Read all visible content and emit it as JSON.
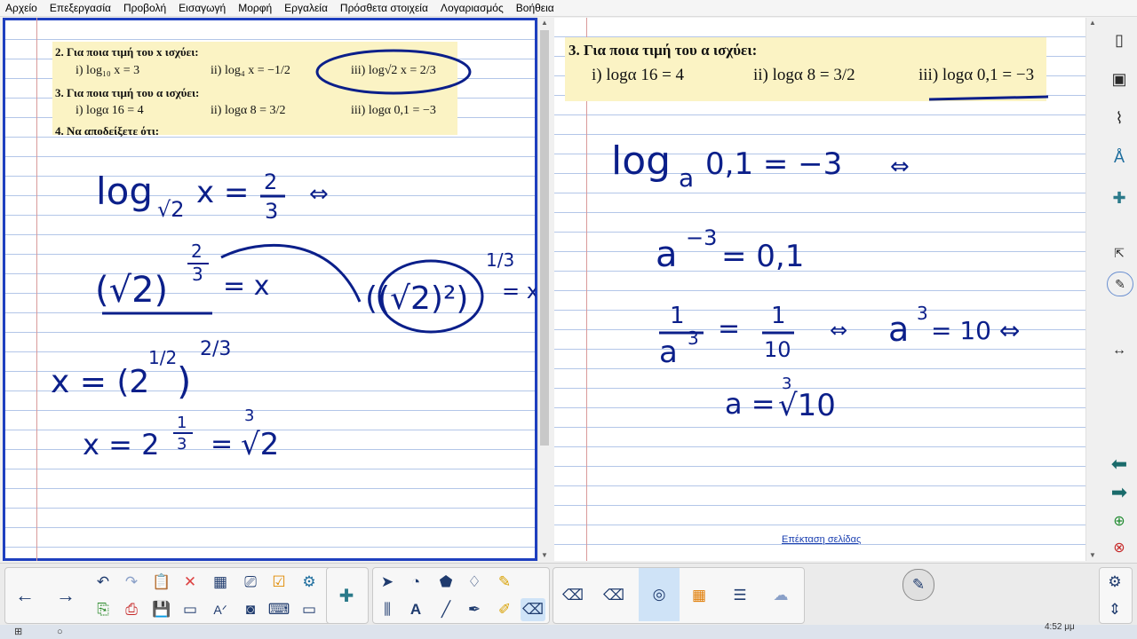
{
  "menu": [
    "Αρχείο",
    "Επεξεργασία",
    "Προβολή",
    "Εισαγωγή",
    "Μορφή",
    "Εργαλεία",
    "Πρόσθετα στοιχεία",
    "Λογαριασμός",
    "Βοήθεια"
  ],
  "left_snippet": {
    "q2_heading": "2. Για ποια τιμή του x ισχύει:",
    "q2_i": "i) log₁₀ x = 3",
    "q2_ii": "ii) log₄ x = −1/2",
    "q2_iii": "iii) log√2 x = 2/3",
    "q3_heading": "3. Για ποια τιμή του α ισχύει:",
    "q3_i": "i) logα 16 = 4",
    "q3_ii": "ii) logα 8 = 3/2",
    "q3_iii": "iii) logα 0,1 = −3",
    "q4_heading": "4. Να αποδείξετε ότι:"
  },
  "right_snippet": {
    "q3_heading": "3. Για ποια τιμή του α ισχύει:",
    "q3_i": "i) logα 16 = 4",
    "q3_ii": "ii) logα 8 = 3/2",
    "q3_iii": "iii) logα 0,1 = −3"
  },
  "left_handwriting": {
    "l1a": "log",
    "l1b": "√2",
    "l1c": "x =",
    "l1d": "2",
    "l1e": "3",
    "l1f": "⇔",
    "l2a": "(√2)",
    "l2b": "2",
    "l2c": "3",
    "l2d": "= x",
    "l2e": "((√2)²)",
    "l2f": "1/3",
    "l2g": "= x",
    "l3a": "x = (2",
    "l3b": "1/2",
    "l3c": ")",
    "l3d": "2/3",
    "l4a": "x = 2",
    "l4b": "1",
    "l4c": "3",
    "l4d": "=",
    "l4e": "3",
    "l4f": "√2"
  },
  "right_handwriting": {
    "r1a": "log",
    "r1b": "a",
    "r1c": "0,1 = −3",
    "r1d": "⇔",
    "r2a": "a",
    "r2b": "−3",
    "r2c": "= 0,1",
    "r3a": "1",
    "r3b": "a",
    "r3c": "3",
    "r3d": "=",
    "r3e": "1",
    "r3f": "10",
    "r3g": "⇔",
    "r3h": "a",
    "r3i": "3",
    "r3j": "= 10 ⇔",
    "r4a": "a =",
    "r4b": "3",
    "r4c": "√10"
  },
  "page_extension_link": "Επέκταση σελίδας",
  "taskbar": {
    "time": "4:52 μμ"
  },
  "icons": {
    "right_toolbar": [
      "page-icon",
      "gallery-icon",
      "attachment-icon",
      "properties-icon",
      "addons-icon",
      "collapse-icon",
      "pen-icon",
      "resize-icon",
      "previous-page-icon",
      "next-page-icon",
      "add-page-icon",
      "delete-page-icon"
    ],
    "bottom_toolbar": [
      "previous-arrow-icon",
      "next-arrow-icon",
      "undo-icon",
      "redo-icon",
      "paste-icon",
      "delete-icon",
      "table-icon",
      "screen-capture-icon",
      "activity-icon",
      "addons-icon",
      "select-icon",
      "shapes-icon",
      "fill-icon",
      "pen-icon",
      "highlighter-icon",
      "text-icon",
      "line-icon",
      "eraser-icon",
      "magic-pen-icon",
      "settings-icon"
    ]
  },
  "colors": {
    "ink": "#0b1f8a",
    "frame": "#1e3fbf",
    "snippet_bg": "#fbf3c4",
    "rule_line": "#b3c6e8",
    "margin_line": "#d99a9a"
  }
}
